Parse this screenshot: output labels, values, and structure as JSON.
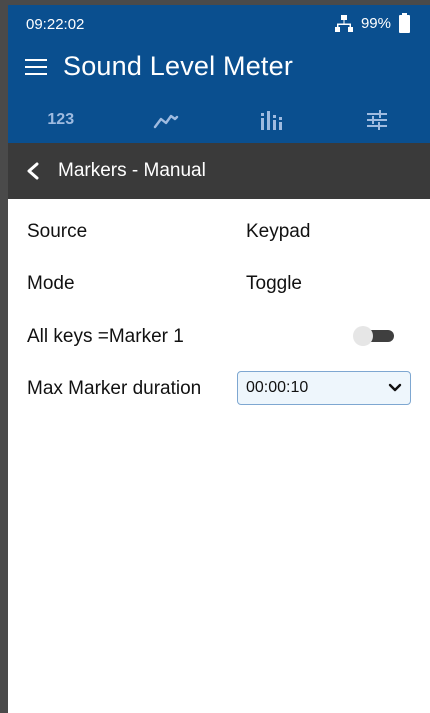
{
  "status": {
    "time": "09:22:02",
    "battery": "99%"
  },
  "appbar": {
    "title": "Sound Level Meter",
    "tab_numeric_label": "123"
  },
  "subheader": {
    "title": "Markers - Manual"
  },
  "settings": {
    "source_label": "Source",
    "source_value": "Keypad",
    "mode_label": "Mode",
    "mode_value": "Toggle",
    "allkeys_label": "All keys =",
    "allkeys_value": "Marker 1",
    "allkeys_toggle": false,
    "max_duration_label": "Max Marker duration",
    "max_duration_value": "00:00:10"
  },
  "colors": {
    "appbar": "#0a4f8f",
    "subheader": "#3a3a3a",
    "tab_icon": "#9fbbe0"
  }
}
